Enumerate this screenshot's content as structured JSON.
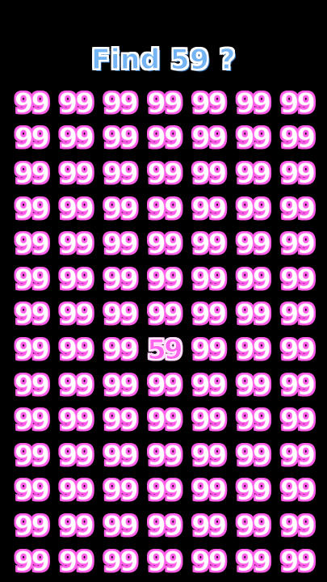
{
  "title": "Find 59 ?",
  "puzzle": {
    "columns": 7,
    "rows": 14,
    "filler": "99",
    "target": "59",
    "target_position": {
      "row": 8,
      "column": 4
    }
  },
  "colors": {
    "background": "#000000",
    "title_fill": "#74b4f4",
    "title_outline": "#ffffff",
    "number_fill": "#ffffff",
    "number_outline": "#ff5ae8"
  }
}
